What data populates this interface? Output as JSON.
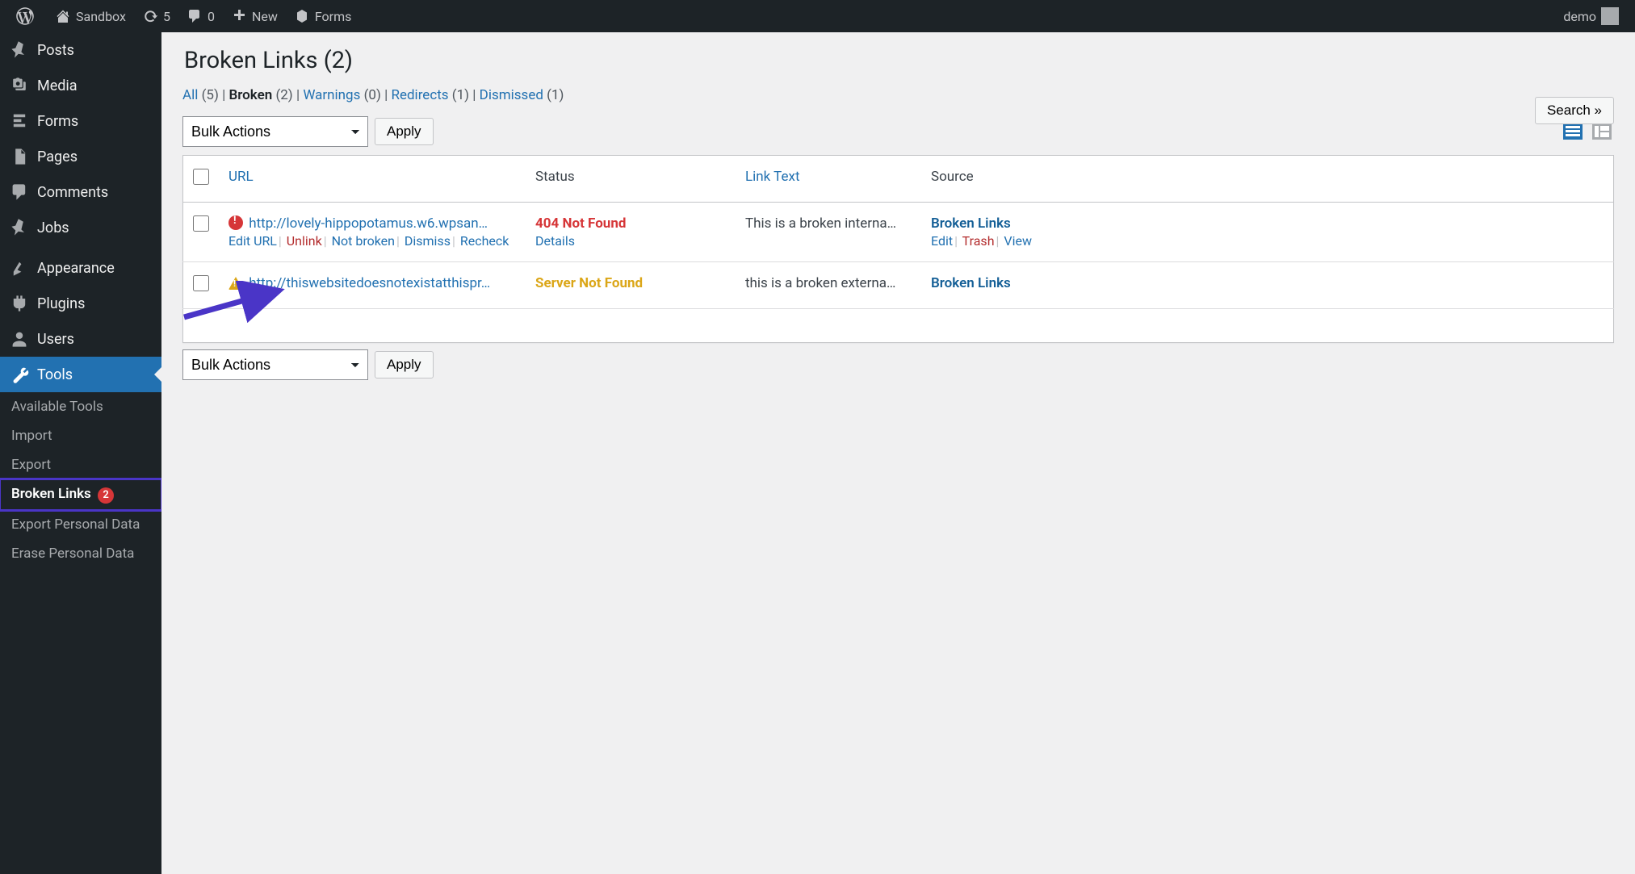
{
  "adminbar": {
    "site_name": "Sandbox",
    "updates_count": "5",
    "comments_count": "0",
    "new_label": "New",
    "forms_label": "Forms",
    "user_label": "demo"
  },
  "sidebar": {
    "items": [
      {
        "key": "posts",
        "label": "Posts"
      },
      {
        "key": "media",
        "label": "Media"
      },
      {
        "key": "forms",
        "label": "Forms"
      },
      {
        "key": "pages",
        "label": "Pages"
      },
      {
        "key": "comments",
        "label": "Comments"
      },
      {
        "key": "jobs",
        "label": "Jobs"
      },
      {
        "key": "appearance",
        "label": "Appearance"
      },
      {
        "key": "plugins",
        "label": "Plugins"
      },
      {
        "key": "users",
        "label": "Users"
      },
      {
        "key": "tools",
        "label": "Tools"
      }
    ],
    "submenu": [
      {
        "label": "Available Tools"
      },
      {
        "label": "Import"
      },
      {
        "label": "Export"
      },
      {
        "label": "Broken Links",
        "count": "2",
        "current": true
      },
      {
        "label": "Export Personal Data"
      },
      {
        "label": "Erase Personal Data"
      }
    ]
  },
  "page": {
    "title": "Broken Links (2)",
    "search_label": "Search »"
  },
  "filters": [
    {
      "label": "All",
      "count": "(5)"
    },
    {
      "label": "Broken",
      "count": "(2)",
      "current": true
    },
    {
      "label": "Warnings",
      "count": "(0)"
    },
    {
      "label": "Redirects",
      "count": "(1)"
    },
    {
      "label": "Dismissed",
      "count": "(1)"
    }
  ],
  "bulk": {
    "placeholder": "Bulk Actions",
    "apply": "Apply"
  },
  "columns": {
    "url": "URL",
    "status": "Status",
    "linktext": "Link Text",
    "source": "Source"
  },
  "rows": [
    {
      "url": "http://lovely-hippopotamus.w6.wpsan…",
      "status": "404 Not Found",
      "status_kind": "error",
      "linktext": "This is a broken interna…",
      "source": "Broken Links",
      "actions": {
        "edit_url": "Edit URL",
        "unlink": "Unlink",
        "not_broken": "Not broken",
        "dismiss": "Dismiss",
        "recheck": "Recheck",
        "details": "Details",
        "edit": "Edit",
        "trash": "Trash",
        "view": "View"
      }
    },
    {
      "url": "http://thiswebsitedoesnotexistatthispr…",
      "status": "Server Not Found",
      "status_kind": "warn",
      "linktext": "this is a broken externa…",
      "source": "Broken Links"
    }
  ]
}
